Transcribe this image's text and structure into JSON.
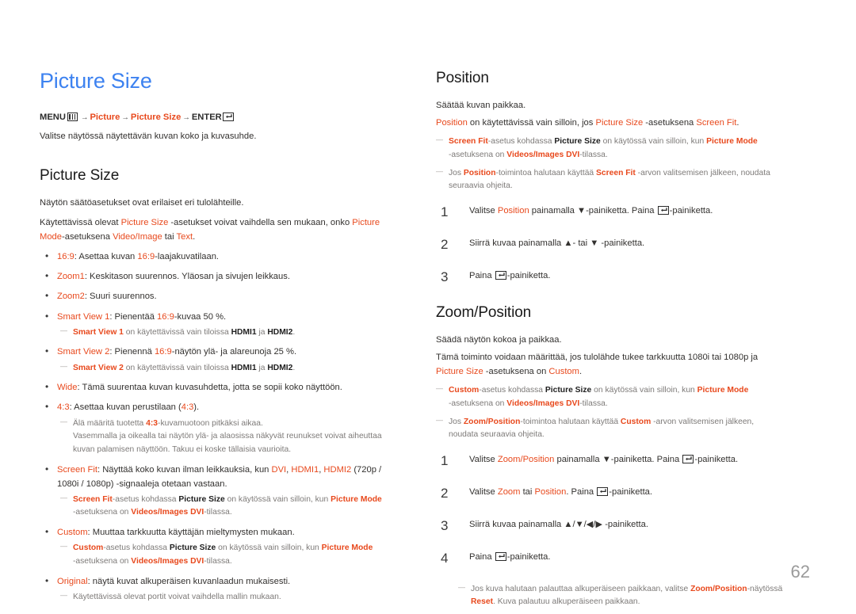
{
  "page_number": "62",
  "colors": {
    "title_blue": "#3d82f0",
    "accent_red": "#e8491d",
    "note_gray": "#7d7a78",
    "body": "#33312f"
  },
  "left_column": {
    "doc_title": "Picture Size",
    "menu_path": {
      "menu_label": "MENU",
      "menu_icon": "menu-icon",
      "arrow1": "→",
      "item1": "Picture",
      "arrow2": "→",
      "item2": "Picture Size",
      "arrow3": "→",
      "enter_label": "ENTER",
      "enter_icon": "enter-icon"
    },
    "intro": "Valitse näytössä näytettävän kuvan koko ja kuvasuhde.",
    "section_title": "Picture Size",
    "para1": "Näytön säätöasetukset ovat erilaiset eri tulolähteille.",
    "para2": {
      "t1": "Käytettävissä olevat ",
      "r1": "Picture Size",
      "t2": " -asetukset voivat vaihdella sen mukaan, onko ",
      "r2": "Picture Mode",
      "t3": "-asetuksena ",
      "r3": "Video/Image",
      "t4": " tai ",
      "r4": "Text",
      "t5": "."
    },
    "bullets": [
      {
        "term": "16:9",
        "t1": ": Asettaa kuvan ",
        "term2": "16:9",
        "t2": "-laajakuvatilaan."
      },
      {
        "term": "Zoom1",
        "t1": ": Keskitason suurennos. Yläosan ja sivujen leikkaus."
      },
      {
        "term": "Zoom2",
        "t1": ": Suuri suurennos."
      },
      {
        "term": "Smart View 1",
        "t1": ": Pienentää ",
        "term2": "16:9",
        "t2": "-kuvaa 50 %."
      },
      {
        "term": "Smart View 2",
        "t1": ": Pienennä ",
        "term2": "16:9",
        "t2": "-näytön ylä- ja alareunoja 25 %."
      },
      {
        "term": "Wide",
        "t1": ": Tämä suurentaa kuvan kuvasuhdetta, jotta se sopii koko näyttöön."
      },
      {
        "term": "4:3",
        "t1": ": Asettaa kuvan perustilaan (",
        "term2": "4:3",
        "t2": ")."
      },
      {
        "term": "Screen Fit",
        "t1": ": Näyttää koko kuvan ilman leikkauksia, kun "
      },
      {
        "term": "Custom",
        "t1": ": Muuttaa tarkkuutta käyttäjän mieltymysten mukaan."
      },
      {
        "term": "Original",
        "t1": ": näytä kuvat alkuperäisen kuvanlaadun mukaisesti."
      }
    ],
    "note_smartview1": {
      "r1": "Smart View 1",
      "t1": " on käytettävissä vain tiloissa ",
      "b1": "HDMI1",
      "t2": " ja ",
      "b2": "HDMI2",
      "t3": "."
    },
    "note_smartview2": {
      "r1": "Smart View 2",
      "t1": " on käytettävissä vain tiloissa ",
      "b1": "HDMI1",
      "t2": " ja ",
      "b2": "HDMI2",
      "t3": "."
    },
    "note_43": {
      "t0": "Älä määritä tuotetta ",
      "r1": "4:3",
      "t1": "-kuvamuotoon pitkäksi aikaa.",
      "t2": "Vasemmalla ja oikealla tai näytön ylä- ja alaosissa näkyvät reunukset voivat aiheuttaa kuvan palamisen näyttöön. Takuu ei koske tällaisia vaurioita."
    },
    "screenfit_signals": {
      "r1": "DVI",
      "t1": ", ",
      "r2": "HDMI1",
      "t2": ", ",
      "r3": "HDMI2",
      "t3": " (720p / 1080i / 1080p) -signaaleja otetaan vastaan."
    },
    "note_screenfit": {
      "r1": "Screen Fit",
      "t1": "-asetus kohdassa ",
      "b1": "Picture Size",
      "t2": " on käytössä vain silloin, kun ",
      "r2": "Picture Mode",
      "t3": "-asetuksena on ",
      "r3": "Videos/Images DVI",
      "t4": "-tilassa."
    },
    "note_custom": {
      "r1": "Custom",
      "t1": "-asetus kohdassa ",
      "b1": "Picture Size",
      "t2": " on käytössä vain silloin, kun ",
      "r2": "Picture Mode",
      "t3": "-asetuksena on ",
      "r3": "Videos/Images DVI",
      "t4": "-tilassa."
    },
    "note_original": "Käytettävissä olevat portit voivat vaihdella mallin mukaan."
  },
  "right_column": {
    "position": {
      "title": "Position",
      "para1": "Säätää kuvan paikkaa.",
      "para2": {
        "r1": "Position",
        "t1": " on käytettävissä vain silloin, jos ",
        "r2": "Picture Size",
        "t2": " -asetuksena ",
        "r3": "Screen Fit",
        "t3": "."
      },
      "note1": {
        "r1": "Screen Fit",
        "t1": "-asetus kohdassa ",
        "b1": "Picture Size",
        "t2": " on käytössä vain silloin, kun ",
        "r2": "Picture Mode",
        "t3": "-asetuksena on ",
        "r3": "Videos/Images DVI",
        "t4": "-tilassa."
      },
      "note2": {
        "t0": "Jos ",
        "r1": "Position",
        "t1": "-toimintoa halutaan käyttää ",
        "r2": "Screen Fit",
        "t2": " -arvon valitsemisen jälkeen, noudata seuraavia ohjeita."
      },
      "steps": [
        {
          "num": "1",
          "t1": "Valitse ",
          "r1": "Position",
          "t2": " painamalla ",
          "ar": "▼",
          "t3": "-painiketta. Paina ",
          "icon": "enter-icon",
          "t4": "-painiketta."
        },
        {
          "num": "2",
          "t1": "Siirrä kuvaa painamalla ",
          "ar": "▲",
          "t2": "- tai ",
          "ar2": "▼",
          "t3": " -painiketta."
        },
        {
          "num": "3",
          "t1": "Paina ",
          "icon": "enter-icon",
          "t2": "-painiketta."
        }
      ]
    },
    "zoom_position": {
      "title": "Zoom/Position",
      "para1": "Säädä näytön kokoa ja paikkaa.",
      "para2": {
        "t1": "Tämä toiminto voidaan määrittää, jos tulolähde tukee tarkkuutta 1080i tai 1080p ja ",
        "r1": "Picture Size",
        "t2": " -asetuksena on ",
        "r2": "Custom",
        "t3": "."
      },
      "note1": {
        "r1": "Custom",
        "t1": "-asetus kohdassa ",
        "b1": "Picture Size",
        "t2": " on käytössä vain silloin, kun ",
        "r2": "Picture Mode",
        "t3": "-asetuksena on ",
        "r3": "Videos/Images DVI",
        "t4": "-tilassa."
      },
      "note2": {
        "t0": "Jos ",
        "r1": "Zoom/Position",
        "t1": "-toimintoa halutaan käyttää ",
        "r2": "Custom",
        "t2": " -arvon valitsemisen jälkeen, noudata seuraavia ohjeita."
      },
      "steps": [
        {
          "num": "1",
          "t1": "Valitse ",
          "r1": "Zoom/Position",
          "t2": " painamalla ",
          "ar": "▼",
          "t3": "-painiketta. Paina ",
          "icon": "enter-icon",
          "t4": "-painiketta."
        },
        {
          "num": "2",
          "t1": "Valitse ",
          "r1": "Zoom",
          "t2": " tai ",
          "r2": "Position",
          "t3": ". Paina ",
          "icon": "enter-icon",
          "t4": "-painiketta."
        },
        {
          "num": "3",
          "t1": "Siirrä kuvaa painamalla ",
          "ar": "▲/▼/◀/▶",
          "t2": " -painiketta."
        },
        {
          "num": "4",
          "t1": "Paina ",
          "icon": "enter-icon",
          "t2": "-painiketta."
        }
      ],
      "note_reset": {
        "t0": "Jos kuva halutaan palauttaa alkuperäiseen paikkaan, valitse ",
        "r1": "Zoom/Position",
        "t1": "-näytössä ",
        "r2": "Reset",
        "t2": ". Kuva palautuu alkuperäiseen paikkaan."
      }
    }
  }
}
